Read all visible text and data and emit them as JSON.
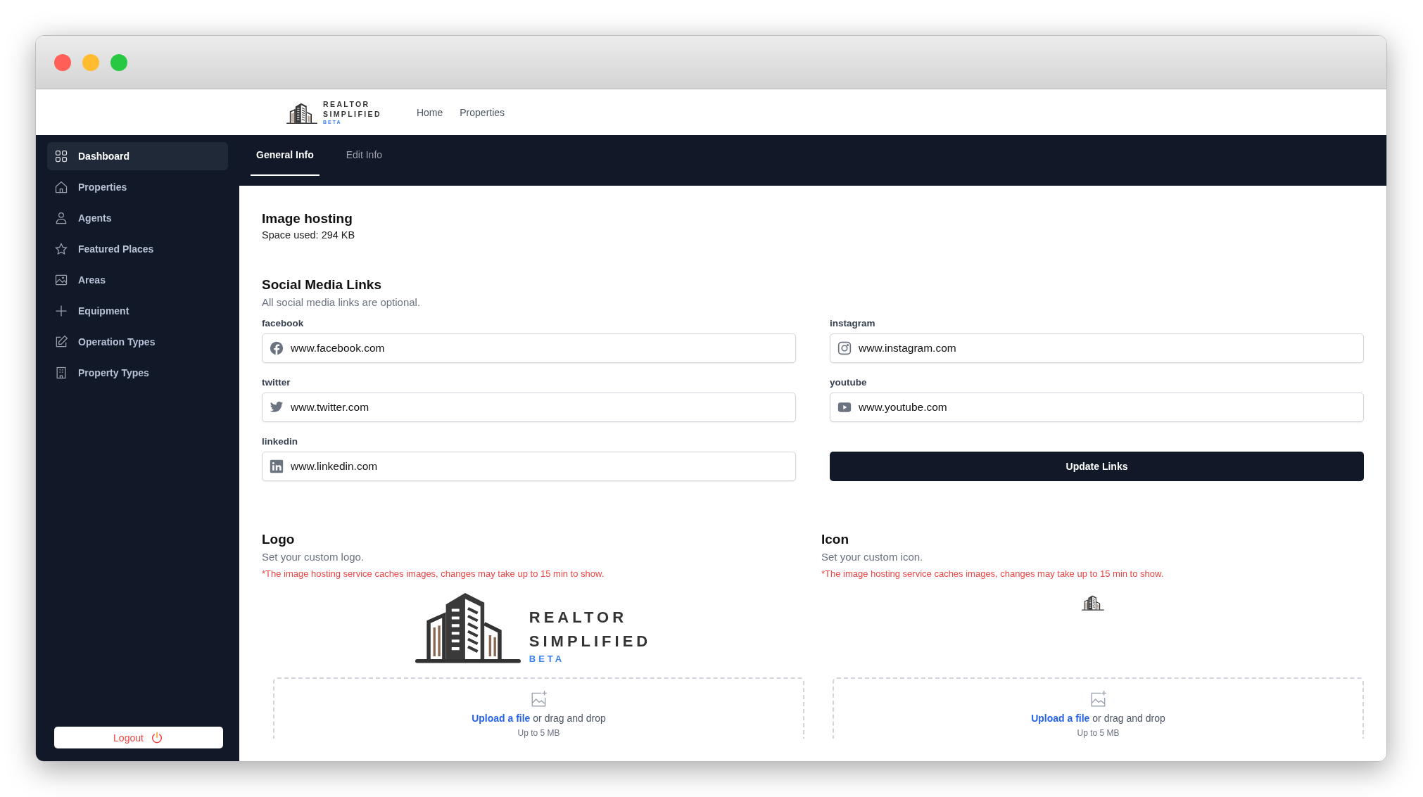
{
  "header": {
    "logo": {
      "line1": "REALTOR",
      "line2": "SIMPLIFIED",
      "badge": "BETA"
    },
    "nav": [
      {
        "label": "Home"
      },
      {
        "label": "Properties"
      }
    ]
  },
  "sidebar": {
    "items": [
      {
        "label": "Dashboard",
        "selected": true
      },
      {
        "label": "Properties",
        "selected": false
      },
      {
        "label": "Agents",
        "selected": false
      },
      {
        "label": "Featured Places",
        "selected": false
      },
      {
        "label": "Areas",
        "selected": false
      },
      {
        "label": "Equipment",
        "selected": false
      },
      {
        "label": "Operation Types",
        "selected": false
      },
      {
        "label": "Property Types",
        "selected": false
      }
    ],
    "logout": "Logout"
  },
  "tabs": [
    {
      "label": "General Info",
      "selected": true
    },
    {
      "label": "Edit Info",
      "selected": false
    }
  ],
  "image_hosting": {
    "title": "Image hosting",
    "usage": "Space used: 294 KB"
  },
  "social": {
    "title": "Social Media Links",
    "subtitle": "All social media links are optional.",
    "fields": [
      {
        "kind": "facebook",
        "label": "facebook",
        "value": "www.facebook.com"
      },
      {
        "kind": "instagram",
        "label": "instagram",
        "value": "www.instagram.com"
      },
      {
        "kind": "twitter",
        "label": "twitter",
        "value": "www.twitter.com"
      },
      {
        "kind": "youtube",
        "label": "youtube",
        "value": "www.youtube.com"
      },
      {
        "kind": "linkedin",
        "label": "linkedin",
        "value": "www.linkedin.com"
      }
    ],
    "button": "Update Links"
  },
  "uploads": [
    {
      "title": "Logo",
      "subtitle": "Set your custom logo.",
      "warning": "*The image hosting service caches images, changes may take up to 15 min to show.",
      "preview": {
        "kind": "logo",
        "line1": "REALTOR",
        "line2": "SIMPLIFIED",
        "badge": "BETA"
      },
      "link": "Upload a file",
      "rest": " or drag and drop",
      "limit": "Up to 5 MB"
    },
    {
      "title": "Icon",
      "subtitle": "Set your custom icon.",
      "warning": "*The image hosting service caches images, changes may take up to 15 min to show.",
      "preview": {
        "kind": "icon"
      },
      "link": "Upload a file",
      "rest": " or drag and drop",
      "limit": "Up to 5 MB"
    }
  ]
}
